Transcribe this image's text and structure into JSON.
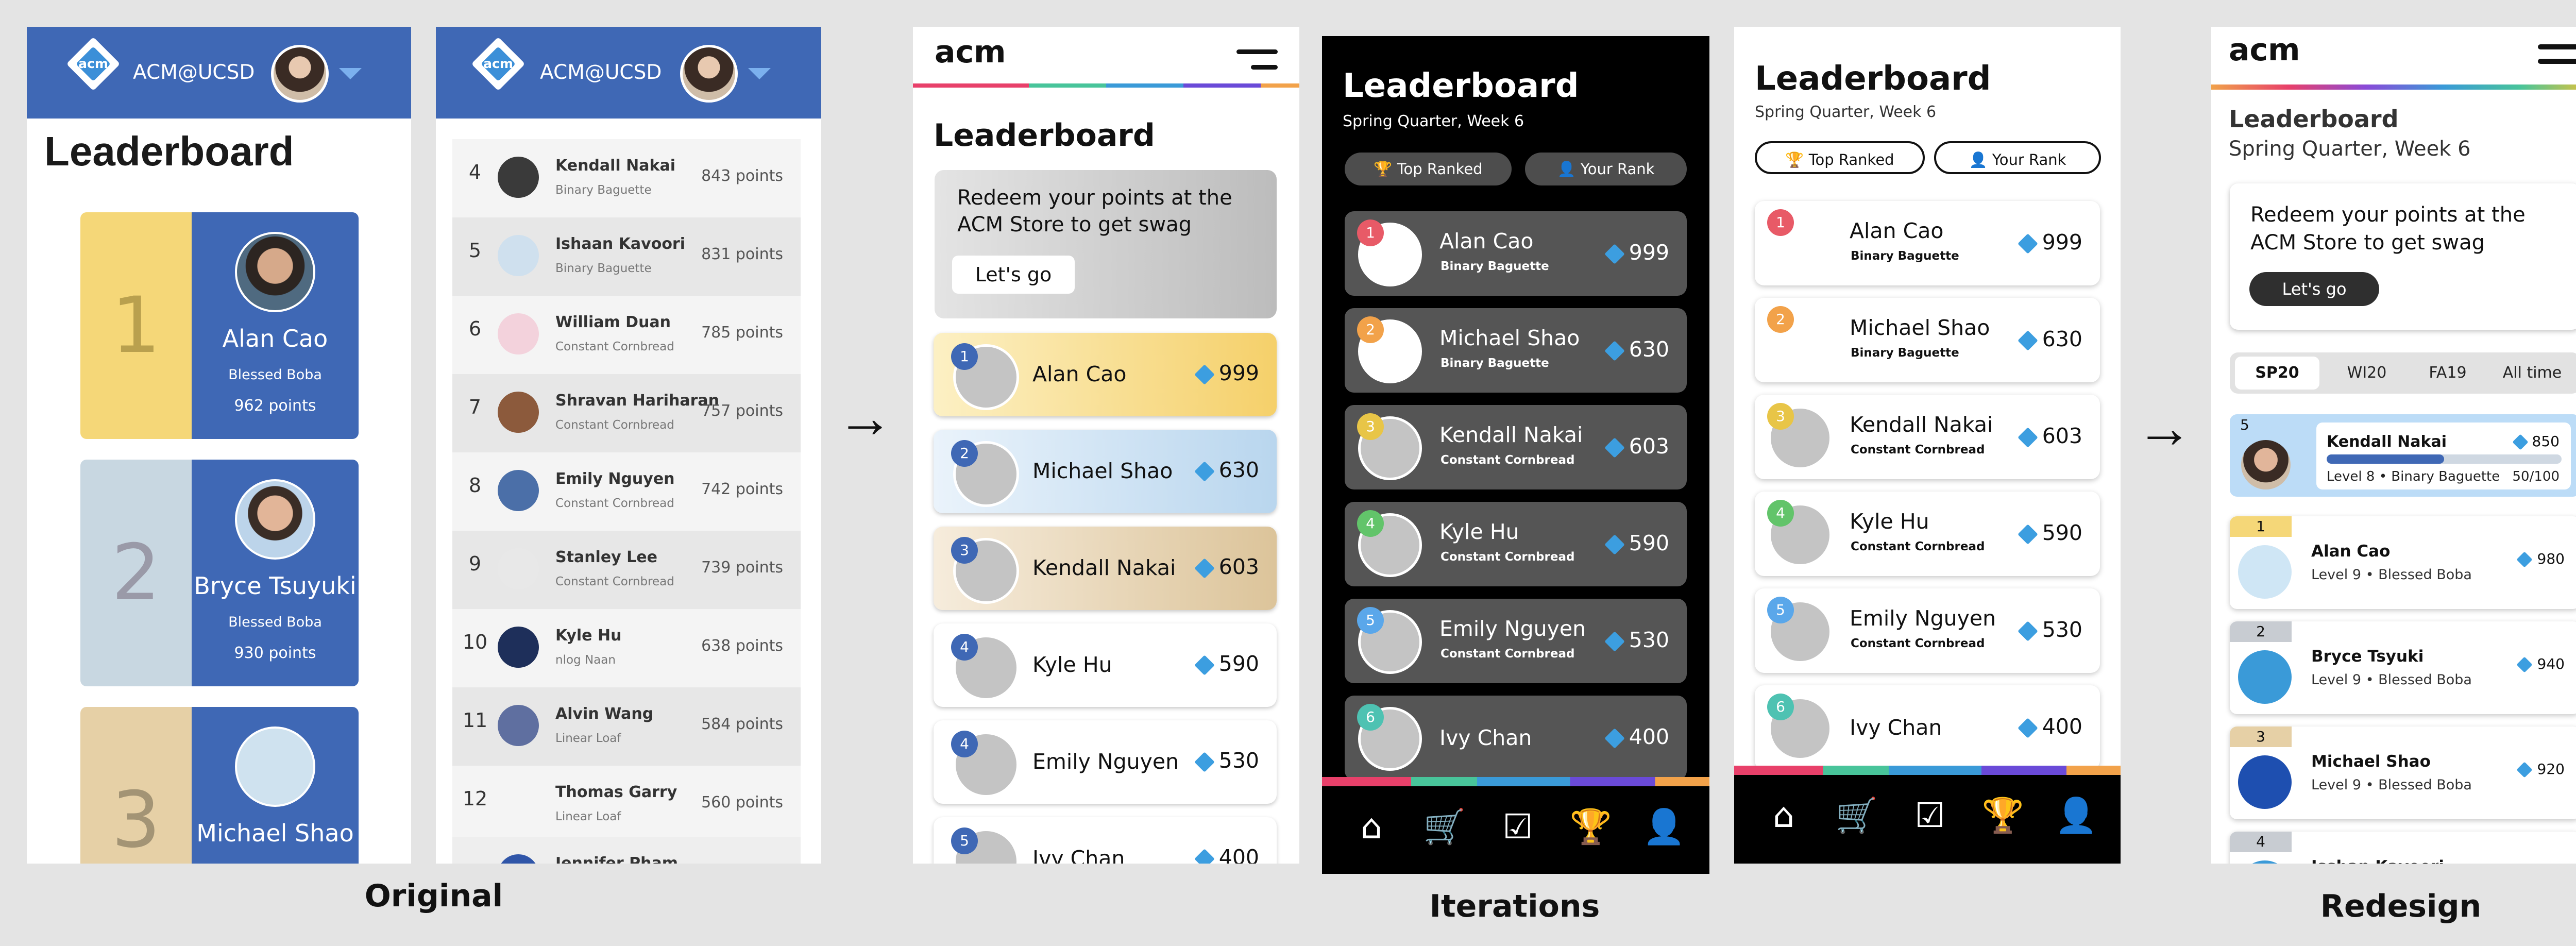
{
  "captions": {
    "original": "Original",
    "iterations": "Iterations",
    "redesign": "Redesign"
  },
  "arrows": [
    "→",
    "→"
  ],
  "org": "ACM@UCSD",
  "acm_logo": "acm",
  "heading": "Leaderboard",
  "subheading": "Spring Quarter, Week 6",
  "panel1_cards": [
    {
      "rank": "1",
      "name": "Alan Cao",
      "team": "Blessed Boba",
      "points": "962 points",
      "color": "#f5d778"
    },
    {
      "rank": "2",
      "name": "Bryce Tsuyuki",
      "team": "Blessed Boba",
      "points": "930 points",
      "color": "#c8d7e1"
    },
    {
      "rank": "3",
      "name": "Michael Shao",
      "team": "",
      "points": "",
      "color": "#e6d0a6"
    }
  ],
  "panel2_rows": [
    {
      "rank": "4",
      "name": "Kendall Nakai",
      "team": "Binary Baguette",
      "points": "843 points"
    },
    {
      "rank": "5",
      "name": "Ishaan Kavoori",
      "team": "Binary Baguette",
      "points": "831 points"
    },
    {
      "rank": "6",
      "name": "William Duan",
      "team": "Constant Cornbread",
      "points": "785 points"
    },
    {
      "rank": "7",
      "name": "Shravan Hariharan",
      "team": "Constant Cornbread",
      "points": "757 points"
    },
    {
      "rank": "8",
      "name": "Emily Nguyen",
      "team": "Constant Cornbread",
      "points": "742 points"
    },
    {
      "rank": "9",
      "name": "Stanley Lee",
      "team": "Constant Cornbread",
      "points": "739 points"
    },
    {
      "rank": "10",
      "name": "Kyle Hu",
      "team": "nlog Naan",
      "points": "638 points"
    },
    {
      "rank": "11",
      "name": "Alvin Wang",
      "team": "Linear Loaf",
      "points": "584 points"
    },
    {
      "rank": "12",
      "name": "Thomas Garry",
      "team": "Linear Loaf",
      "points": "560 points"
    }
  ],
  "panel2_partial_name": "Jennifer Pham",
  "panel3": {
    "promo": "Redeem your points at the ACM Store to get swag",
    "cta": "Let's go",
    "rows": [
      {
        "rank": "1",
        "name": "Alan Cao",
        "score": "999"
      },
      {
        "rank": "2",
        "name": "Michael Shao",
        "score": "630"
      },
      {
        "rank": "3",
        "name": "Kendall Nakai",
        "score": "603"
      },
      {
        "rank": "4",
        "name": "Kyle Hu",
        "score": "590"
      },
      {
        "rank": "4",
        "name": "Emily Nguyen",
        "score": "530"
      },
      {
        "rank": "5",
        "name": "Ivy Chan",
        "score": "400"
      }
    ]
  },
  "tabs": {
    "top_ranked": "Top Ranked",
    "your_rank": "Your Rank"
  },
  "iter_rows": [
    {
      "rank": "1",
      "name": "Alan Cao",
      "team": "Binary Baguette",
      "score": "999",
      "badge": "#e85a67"
    },
    {
      "rank": "2",
      "name": "Michael Shao",
      "team": "Binary Baguette",
      "score": "630",
      "badge": "#f2a24a"
    },
    {
      "rank": "3",
      "name": "Kendall Nakai",
      "team": "Constant Cornbread",
      "score": "603",
      "badge": "#e8c547"
    },
    {
      "rank": "4",
      "name": "Kyle Hu",
      "team": "Constant Cornbread",
      "score": "590",
      "badge": "#62c46a"
    },
    {
      "rank": "5",
      "name": "Emily Nguyen",
      "team": "Constant Cornbread",
      "score": "530",
      "badge": "#5aa7ea"
    },
    {
      "rank": "6",
      "name": "Ivy Chan",
      "team": "",
      "score": "400",
      "badge": "#4ec2b2"
    }
  ],
  "redesign": {
    "promo": "Redeem your points at the ACM Store to get swag",
    "cta": "Let's go",
    "terms": [
      "SP20",
      "WI20",
      "FA19",
      "All time"
    ],
    "me": {
      "rank": "5",
      "name": "Kendall Nakai",
      "score": "850",
      "level": "Level 8 • Binary Baguette",
      "progress": "50/100",
      "progress_fraction": 0.5
    },
    "rows": [
      {
        "rank": "1",
        "name": "Alan Cao",
        "level": "Level 9 • Blessed Boba",
        "score": "980",
        "tag": "#f5d778"
      },
      {
        "rank": "2",
        "name": "Bryce Tsyuki",
        "level": "Level 9 • Blessed Boba",
        "score": "940",
        "tag": "#c8ccd2"
      },
      {
        "rank": "3",
        "name": "Michael Shao",
        "level": "Level 9 • Blessed Boba",
        "score": "920",
        "tag": "#e6d0a6"
      },
      {
        "rank": "4",
        "name": "Isshan Kavoori",
        "level": "",
        "score": "",
        "tag": "#c8ccd2"
      }
    ]
  },
  "nav_icons": [
    "home-icon",
    "cart-icon",
    "checkbox-icon",
    "trophy-icon",
    "person-icon"
  ],
  "colors": {
    "acm_blue": "#3f68b5",
    "gem": "#3c9ee0",
    "stripe": [
      "#e8406a",
      "#48c49a",
      "#3a9ad8",
      "#6a4ad8",
      "#f2a24a"
    ]
  }
}
